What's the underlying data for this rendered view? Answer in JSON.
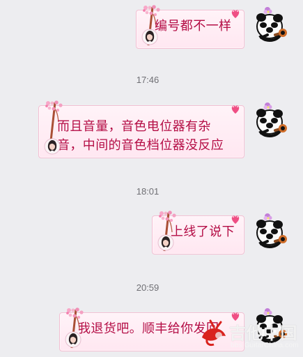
{
  "messages": [
    {
      "type": "outgoing",
      "text": "编号都不一样"
    },
    {
      "type": "timestamp",
      "text": "17:46"
    },
    {
      "type": "outgoing",
      "text_lines": [
        "而且音量，音色电位器有杂",
        "音，中间的音色档位器没反应"
      ]
    },
    {
      "type": "timestamp",
      "text": "18:01"
    },
    {
      "type": "outgoing",
      "text": "上线了说下"
    },
    {
      "type": "timestamp",
      "text": "20:59"
    },
    {
      "type": "outgoing",
      "text": "我退货吧。顺丰给你发回"
    }
  ],
  "watermark": {
    "logo_text": "吉他中国",
    "url": "bbs.GuitarChina.com"
  },
  "colors": {
    "background": "#ededf0",
    "bubble_text": "#b40d45",
    "bubble_fill": "#ffeff6",
    "bubble_border": "#f3bfd3"
  },
  "icons": [
    "cherry-branch-icon",
    "heart-sticker-icon",
    "girl-avatar-icon",
    "panda-avatar-icon",
    "guitarchina-logo-icon"
  ]
}
